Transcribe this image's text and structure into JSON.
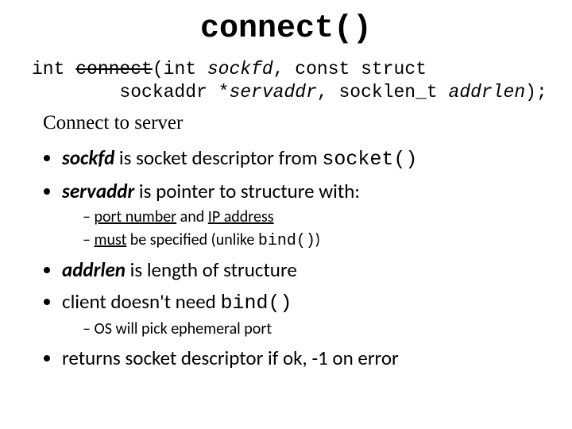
{
  "title": "connect()",
  "signature": {
    "ret": "int ",
    "fn": "connect",
    "open": "(int ",
    "p1": "sockfd",
    "c1": ", const struct",
    "line2a": "        sockaddr *",
    "p2": "servaddr",
    "c2": ", socklen_t ",
    "p3": "addrlen",
    "close": ");"
  },
  "desc": "Connect to server",
  "b1": {
    "i0": {
      "a": "sockfd",
      "b": " is socket descriptor from ",
      "c": "socket()"
    },
    "i1": {
      "a": "servaddr",
      "b": " is pointer to structure with:"
    },
    "i2": {
      "a": "addrlen",
      "b": " is length of structure"
    },
    "i3": {
      "a": "client doesn't need ",
      "b": "bind()"
    },
    "i4": "returns socket descriptor if ok, -1 on error"
  },
  "b2a": {
    "i0": {
      "a": "port number",
      "b": " and ",
      "c": "IP address"
    },
    "i1": {
      "a": "must",
      "b": " be specified (unlike ",
      "c": "bind()",
      "d": ")"
    }
  },
  "b2b": {
    "i0": "OS will pick ephemeral port"
  }
}
